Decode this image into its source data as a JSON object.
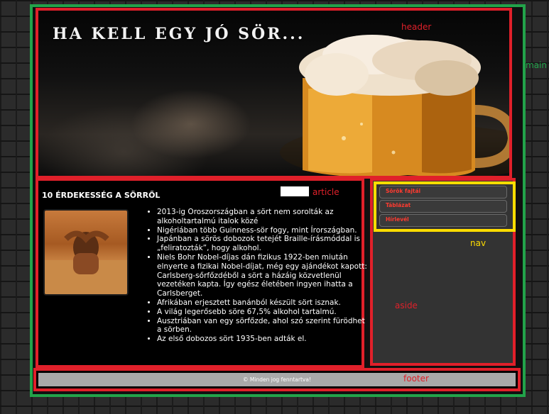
{
  "header": {
    "title": "HA KELL EGY JÓ SÖR..."
  },
  "article": {
    "title": "10 ÉRDEKESSÉG A SÖRRŐL",
    "facts": [
      "2013-ig Oroszországban a sört nem sorolták az alkoholtartalmú italok közé",
      "Nigériában több Guinness-sör fogy, mint Írországban.",
      "Japánban a sörös dobozok tetejét Braille-írásmóddal is „feliratozták”, hogy alkohol.",
      "Niels Bohr Nobel-díjas dán fizikus 1922-ben miután elnyerte a fizikai Nobel-díjat, még egy ajándékot kapott: Carlsberg-sőrfőzdéből a sört a házáig közvetlenül vezetéken kapta. Így egész életében ingyen ihatta a Carlsberget.",
      "Afrikában erjesztett banánból készült sört isznak.",
      "A világ legerősebb söre 67,5% alkohol tartalmú.",
      "Ausztriában van egy sörfőzde, ahol szó szerint fürödhet a sörben.",
      "Az első dobozos sört 1935-ben adták el."
    ]
  },
  "nav": {
    "items": [
      "Sörök fajtái",
      "Táblázat",
      "Hírlevél"
    ]
  },
  "footer": {
    "text": "© Minden jog fenntartva!"
  },
  "labels": {
    "main": "main",
    "header": "header",
    "article": "article",
    "nav": "nav",
    "aside": "aside",
    "footer": "footer"
  },
  "colors": {
    "main_border": "#22a34a",
    "section_border": "#e0202a",
    "nav_border": "#ffdd00",
    "nav_text": "#ff3b30",
    "footer_bg": "#a9a9a9",
    "aside_bg": "#333333"
  }
}
